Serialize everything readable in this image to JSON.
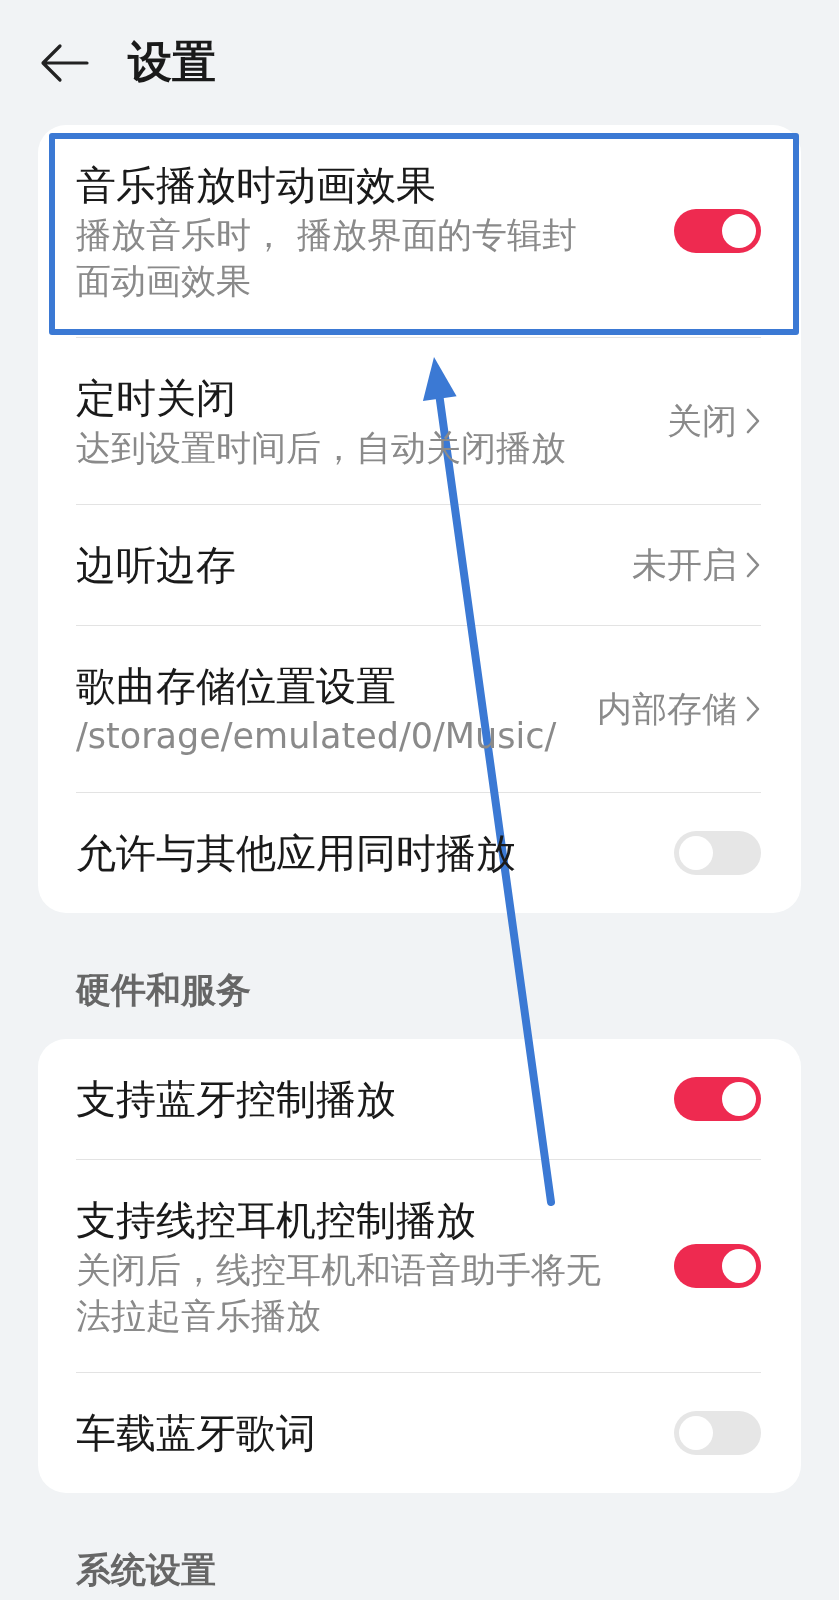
{
  "header": {
    "title": "设置"
  },
  "sections": [
    {
      "items": [
        {
          "kind": "toggle",
          "title": "音乐播放时动画效果",
          "description": "播放音乐时， 播放界面的专辑封面动画效果",
          "on": true,
          "highlighted": true
        },
        {
          "kind": "link",
          "title": "定时关闭",
          "description": "达到设置时间后，自动关闭播放",
          "value": "关闭",
          "highlighted": false
        },
        {
          "kind": "link",
          "title": "边听边存",
          "value": "未开启",
          "highlighted": false
        },
        {
          "kind": "link",
          "title": "歌曲存储位置设置",
          "description": "/storage/emulated/0/Music/",
          "value": "内部存储",
          "highlighted": false
        },
        {
          "kind": "toggle",
          "title": "允许与其他应用同时播放",
          "on": false,
          "highlighted": false
        }
      ]
    },
    {
      "title": "硬件和服务",
      "items": [
        {
          "kind": "toggle",
          "title": "支持蓝牙控制播放",
          "on": true,
          "highlighted": false
        },
        {
          "kind": "toggle",
          "title": "支持线控耳机控制播放",
          "description": "关闭后，线控耳机和语音助手将无法拉起音乐播放",
          "on": true,
          "highlighted": false
        },
        {
          "kind": "toggle",
          "title": "车载蓝牙歌词",
          "on": false,
          "highlighted": false
        }
      ]
    },
    {
      "title": "系统设置"
    }
  ]
}
